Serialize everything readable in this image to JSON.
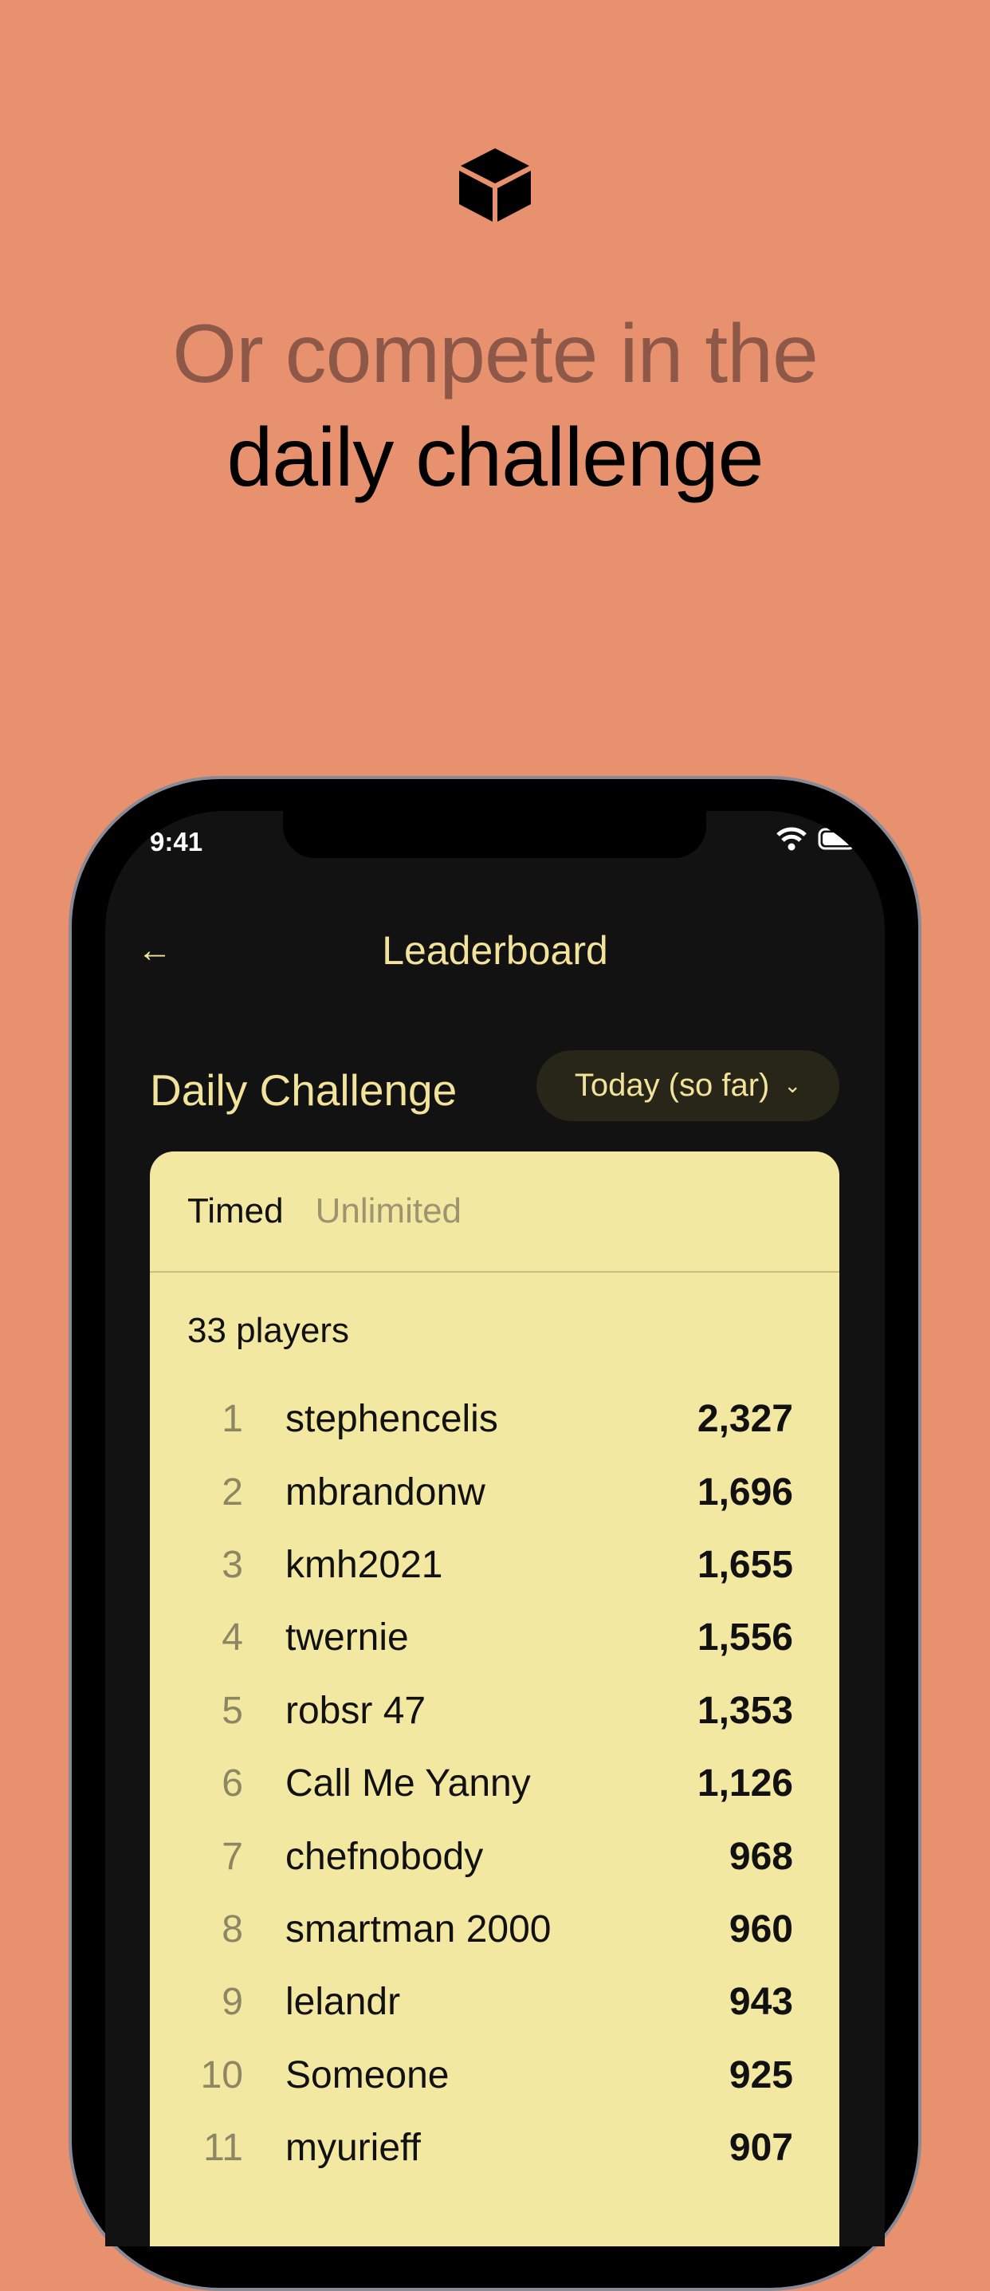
{
  "headline": {
    "line1": "Or compete in the",
    "line2": "daily challenge"
  },
  "colors": {
    "background": "#E8916F",
    "accent": "#F3E39A",
    "card": "#F3E8A2",
    "screen": "#121212"
  },
  "status_bar": {
    "time": "9:41",
    "icons": [
      "wifi-icon",
      "battery-icon"
    ]
  },
  "nav": {
    "title": "Leaderboard",
    "back_icon": "arrow-left-icon"
  },
  "section": {
    "title": "Daily Challenge",
    "dropdown_value": "Today (so far)"
  },
  "tabs": [
    {
      "label": "Timed",
      "active": true
    },
    {
      "label": "Unlimited",
      "active": false
    }
  ],
  "player_count": "33 players",
  "leaderboard": [
    {
      "rank": "1",
      "name": "stephencelis",
      "score": "2,327"
    },
    {
      "rank": "2",
      "name": "mbrandonw",
      "score": "1,696"
    },
    {
      "rank": "3",
      "name": "kmh2021",
      "score": "1,655"
    },
    {
      "rank": "4",
      "name": "twernie",
      "score": "1,556"
    },
    {
      "rank": "5",
      "name": "robsr 47",
      "score": "1,353"
    },
    {
      "rank": "6",
      "name": "Call Me Yanny",
      "score": "1,126"
    },
    {
      "rank": "7",
      "name": "chefnobody",
      "score": "968"
    },
    {
      "rank": "8",
      "name": "smartman 2000",
      "score": "960"
    },
    {
      "rank": "9",
      "name": "lelandr",
      "score": "943"
    },
    {
      "rank": "10",
      "name": "Someone",
      "score": "925"
    },
    {
      "rank": "11",
      "name": "myurieff",
      "score": "907"
    }
  ]
}
